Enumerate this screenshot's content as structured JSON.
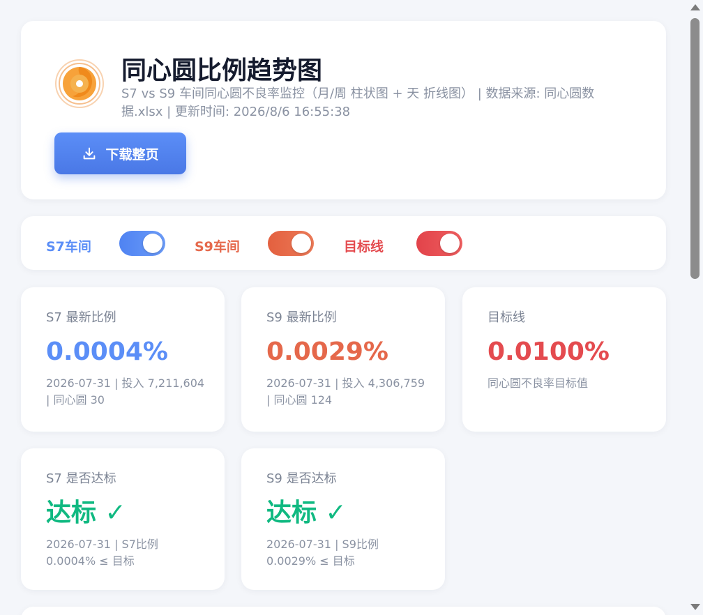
{
  "header": {
    "title": "同心圆比例趋势图",
    "subtitle": "S7 vs S9 车间同心圆不良率监控（月/周 柱状图 + 天 折线图） | 数据来源: 同心圆数据.xlsx | 更新时间: 2026/8/6 16:55:38",
    "download_label": "下载整页"
  },
  "toggles": [
    {
      "label": "S7车间",
      "on": true,
      "color": "#5b8ef7"
    },
    {
      "label": "S9车间",
      "on": true,
      "color": "#e5684b"
    },
    {
      "label": "目标线",
      "on": true,
      "color": "#e44b4f"
    }
  ],
  "stats": {
    "s7_latest": {
      "label": "S7 最新比例",
      "value": "0.0004%",
      "meta": "2026-07-31 | 投入 7,211,604 | 同心圆 30"
    },
    "s9_latest": {
      "label": "S9 最新比例",
      "value": "0.0029%",
      "meta": "2026-07-31 | 投入 4,306,759 | 同心圆 124"
    },
    "target": {
      "label": "目标线",
      "value": "0.0100%",
      "meta": "同心圆不良率目标值"
    },
    "s7_pass": {
      "label": "S7 是否达标",
      "value": "达标 ✓",
      "meta": "2026-07-31 | S7比例 0.0004% ≤ 目标"
    },
    "s9_pass": {
      "label": "S9 是否达标",
      "value": "达标 ✓",
      "meta": "2026-07-31 | S9比例 0.0029% ≤ 目标"
    }
  },
  "colors": {
    "s7": "#5b8ef7",
    "s9": "#e5684b",
    "target": "#e44b4f",
    "pass": "#10b981"
  }
}
